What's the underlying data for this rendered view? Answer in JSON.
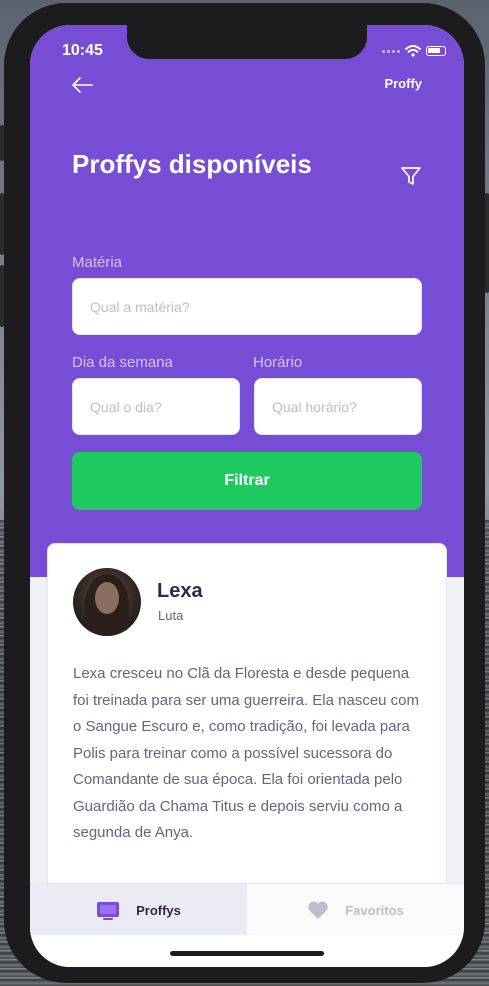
{
  "status_bar": {
    "time": "10:45"
  },
  "header": {
    "brand": "Proffy",
    "title": "Proffys disponíveis"
  },
  "filters": {
    "subject_label": "Matéria",
    "subject_placeholder": "Qual a matéria?",
    "weekday_label": "Dia da semana",
    "weekday_placeholder": "Qual o dia?",
    "time_label": "Horário",
    "time_placeholder": "Qual horário?",
    "submit_label": "Filtrar"
  },
  "teacher": {
    "name": "Lexa",
    "subject": "Luta",
    "bio": "Lexa cresceu no Clã da Floresta e desde pequena foi treinada para ser uma guerreira. Ela nasceu com o Sangue Escuro e, como tradição, foi levada para Polis para treinar como a possível sucessora do Comandante de sua época. Ela foi orientada pelo Guardião da Chama Titus e depois serviu como a segunda de Anya."
  },
  "tabs": [
    {
      "label": "Proffys",
      "icon": "tv-icon",
      "active": true
    },
    {
      "label": "Favoritos",
      "icon": "heart-icon",
      "active": false
    }
  ],
  "colors": {
    "primary": "#774dd6",
    "secondary": "#1ec960",
    "background": "#f0f0f7",
    "title_text": "#32264d",
    "body_text": "#6a6180"
  }
}
